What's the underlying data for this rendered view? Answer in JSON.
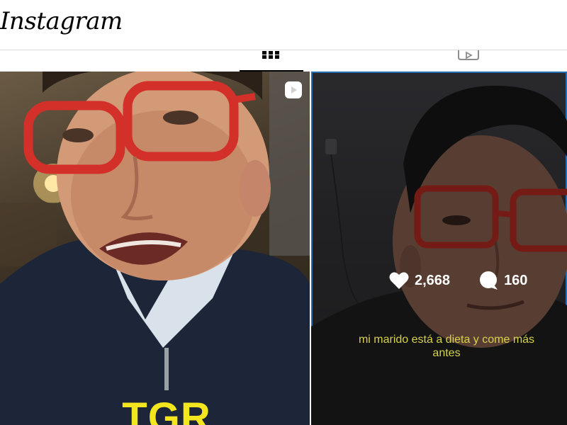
{
  "header": {
    "logo_text": "Instagram"
  },
  "tabs": [
    {
      "icon": "grid-icon",
      "active": true
    },
    {
      "icon": "reels-icon",
      "active": false
    }
  ],
  "posts": [
    {
      "type": "reel",
      "overlay_text": "TGR",
      "badge_icon": "reel-play-icon"
    },
    {
      "type": "post",
      "hovered": true,
      "likes": "2,668",
      "comments": "160",
      "caption_line1": "mi marido está a dieta y come más",
      "caption_line2": "antes"
    }
  ],
  "colors": {
    "accent_selection": "#3897f0",
    "overlay_yellow": "#f3e61e",
    "caption_yellow": "#d6d24a"
  }
}
